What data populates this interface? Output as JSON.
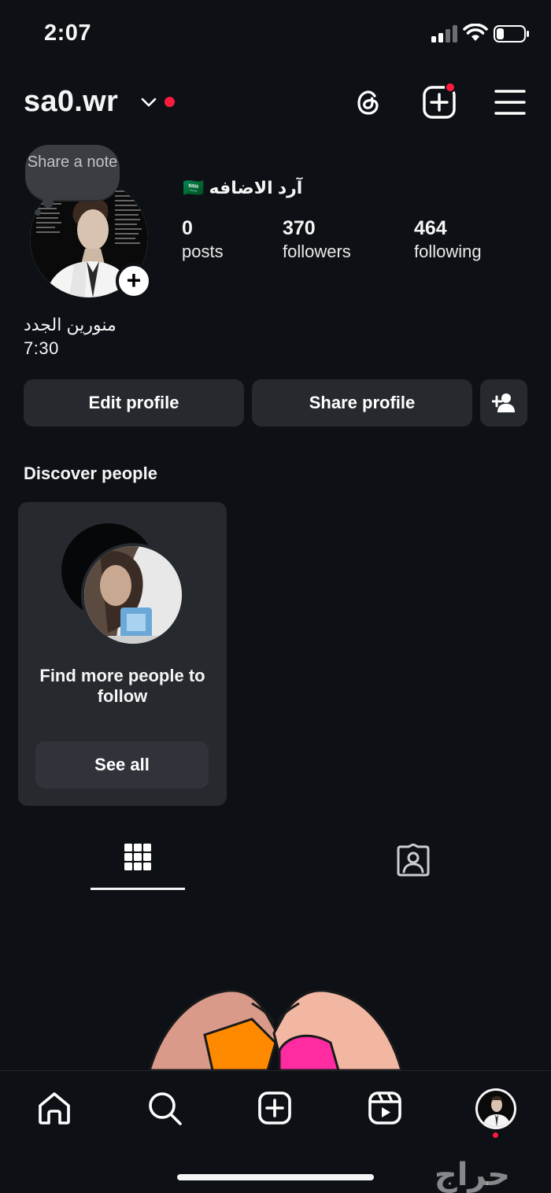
{
  "status": {
    "time": "2:07"
  },
  "header": {
    "username": "sa0.wr"
  },
  "profile": {
    "note_bubble": "Share a note",
    "display_name": "آرد الاضافه",
    "flag": "🇸🇦",
    "stats": [
      {
        "value": "0",
        "label": "posts"
      },
      {
        "value": "370",
        "label": "followers"
      },
      {
        "value": "464",
        "label": "following"
      }
    ],
    "bio_line1": "منورين الجدد",
    "bio_line2": "7:30"
  },
  "actions": {
    "edit_label": "Edit profile",
    "share_label": "Share profile"
  },
  "discover": {
    "title": "Discover people",
    "card_text": "Find more people to follow",
    "see_all_label": "See all"
  },
  "tabs": [
    {
      "icon": "grid-icon",
      "active": true
    },
    {
      "icon": "tagged-icon",
      "active": false
    }
  ],
  "bottom_nav": [
    "home-icon",
    "search-icon",
    "create-icon",
    "reels-icon",
    "profile-avatar"
  ],
  "watermark": "حراج",
  "colors": {
    "background": "#0d1015",
    "button": "#26292e",
    "notification_dot": "#ff1a3d"
  }
}
